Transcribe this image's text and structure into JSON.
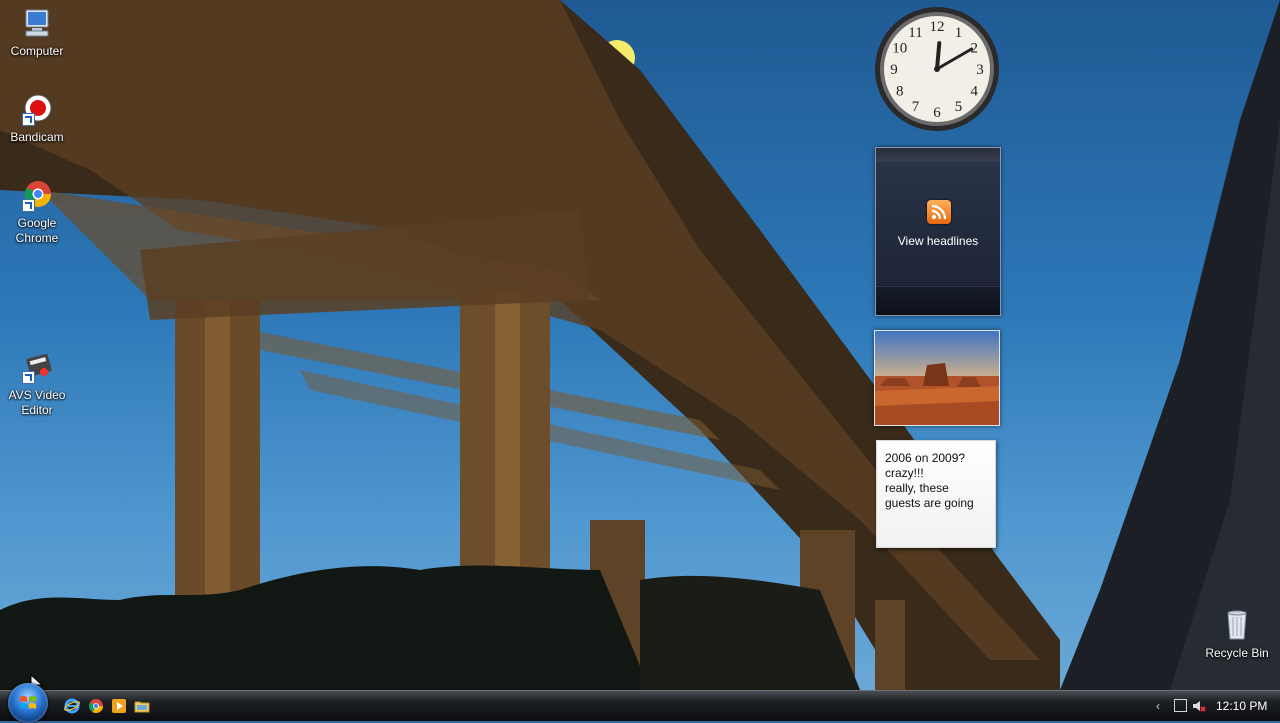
{
  "desktop": {
    "icons": [
      {
        "label": "Computer",
        "icon": "computer-icon"
      },
      {
        "label": "Bandicam",
        "icon": "bandicam-icon"
      },
      {
        "label": "Google Chrome",
        "icon": "chrome-icon"
      },
      {
        "label": "AVS Video Editor",
        "icon": "avs-video-editor-icon"
      },
      {
        "label": "Recycle Bin",
        "icon": "recycle-bin-icon"
      }
    ]
  },
  "gadgets": {
    "clock": {
      "hours": 12,
      "minutes": 10,
      "numerals": [
        "12",
        "1",
        "2",
        "3",
        "4",
        "5",
        "6",
        "7",
        "8",
        "9",
        "10",
        "11"
      ]
    },
    "rss": {
      "label": "View headlines",
      "icon": "rss-feed-icon"
    },
    "notes": {
      "lines": [
        "2006 on 2009?",
        "crazy!!!",
        "really, these",
        "guests are going"
      ]
    }
  },
  "taskbar": {
    "quick_launch": [
      "internet-explorer-icon",
      "chrome-icon",
      "media-player-icon",
      "file-explorer-icon"
    ],
    "tray": {
      "time": "12:10 PM",
      "icons": [
        "show-hidden-icons-chevron",
        "network-icon",
        "volume-muted-icon"
      ]
    }
  },
  "colors": {
    "taskbar": "#0c0d0f",
    "start_orb": "#2d7bd6",
    "rss_orange": "#e8670e"
  }
}
